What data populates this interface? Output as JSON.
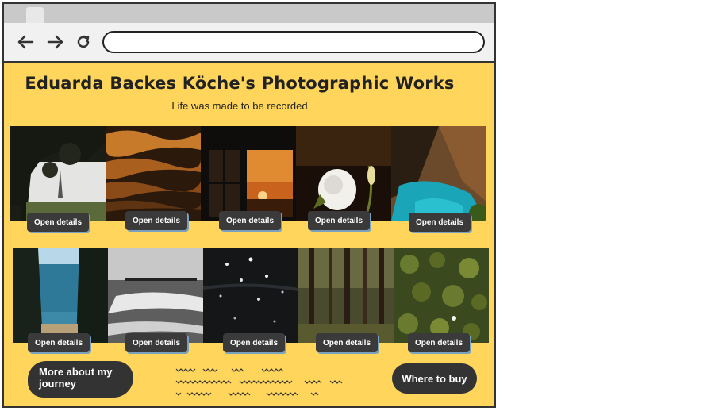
{
  "page": {
    "title": "Eduarda Backes Köche's Photographic Works",
    "subtitle": "Life was made to be recorded"
  },
  "browser": {
    "address_value": "",
    "back_icon": "arrow-left-icon",
    "forward_icon": "arrow-right-icon",
    "reload_icon": "reload-icon"
  },
  "gallery": {
    "button_label": "Open details",
    "row1": [
      {
        "subject": "trees-eiffel-tower"
      },
      {
        "subject": "golden-water-reflection"
      },
      {
        "subject": "window-sunset"
      },
      {
        "subject": "white-rose"
      },
      {
        "subject": "turquoise-cove"
      }
    ],
    "row2": [
      {
        "subject": "sea-between-cypress"
      },
      {
        "subject": "silver-sea-pier"
      },
      {
        "subject": "dark-water-sparkles"
      },
      {
        "subject": "forest-trunks"
      },
      {
        "subject": "water-lilies"
      }
    ]
  },
  "footer": {
    "more_label": "More about my journey",
    "buy_label": "Where to buy"
  },
  "colors": {
    "background": "#ffd65b",
    "button": "#3a3a3a",
    "text": "#222222"
  }
}
